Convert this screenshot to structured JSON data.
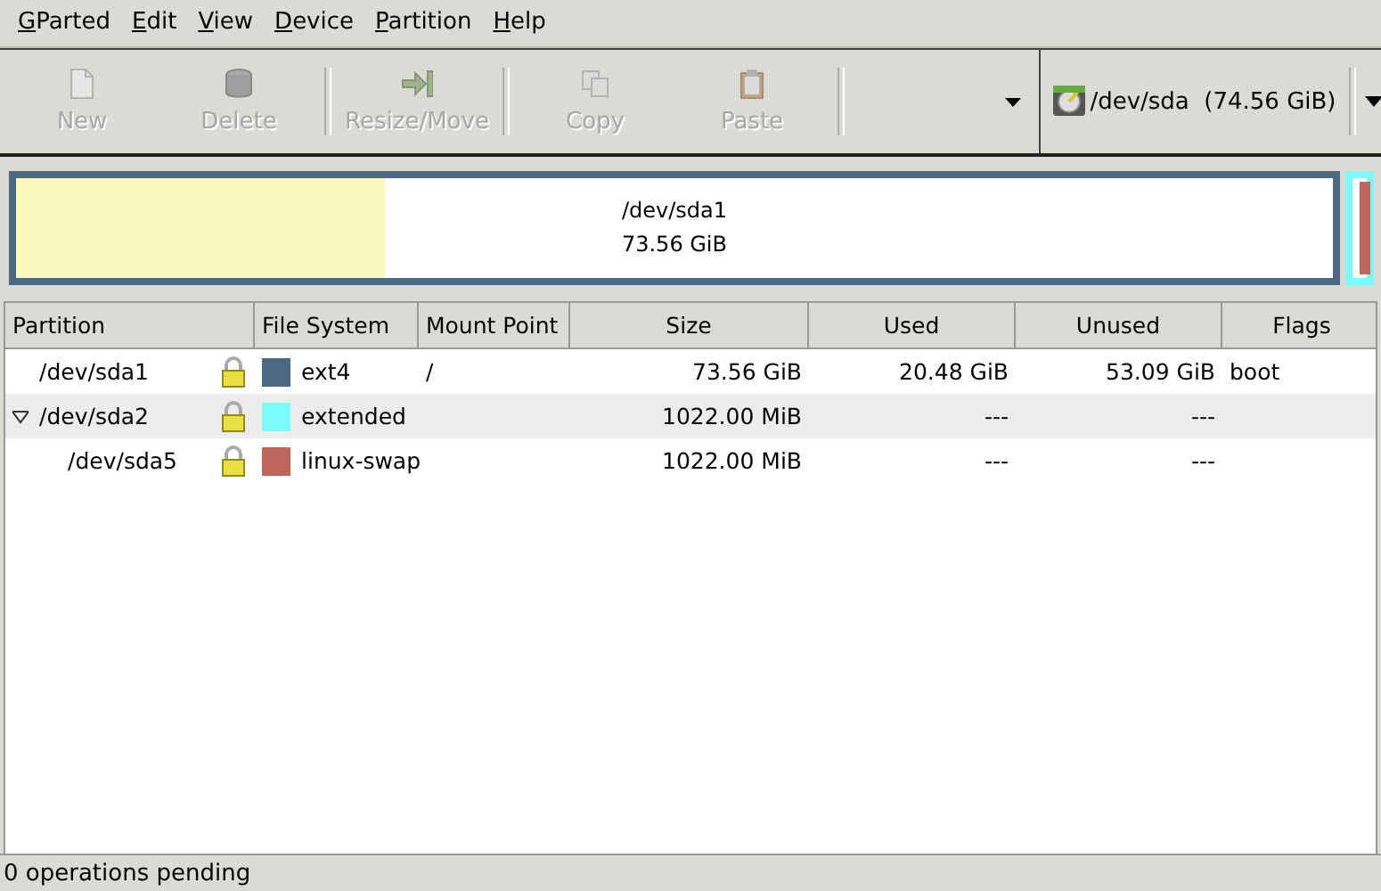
{
  "menu": [
    {
      "label": "GParted"
    },
    {
      "label": "Edit"
    },
    {
      "label": "View"
    },
    {
      "label": "Device"
    },
    {
      "label": "Partition"
    },
    {
      "label": "Help"
    }
  ],
  "toolbar": {
    "buttons": [
      {
        "kind": "new",
        "label": "New",
        "disabled": true,
        "separator_after": false
      },
      {
        "kind": "delete",
        "label": "Delete",
        "disabled": true,
        "separator_after": true
      },
      {
        "kind": "resize",
        "label": "Resize/Move",
        "disabled": true,
        "separator_after": true
      },
      {
        "kind": "copy",
        "label": "Copy",
        "disabled": true,
        "separator_after": false
      },
      {
        "kind": "paste",
        "label": "Paste",
        "disabled": true,
        "separator_after": true
      }
    ],
    "device": {
      "label": "/dev/sda  (74.56 GiB)"
    }
  },
  "disk_map": {
    "partitions": [
      {
        "kind": "primary",
        "name": "/dev/sda1",
        "size": "73.56 GiB",
        "color": "#4b6983",
        "level": 0.28
      },
      {
        "kind": "extended",
        "color": "#7bfbfb",
        "children": [
          {
            "color": "#c1665a"
          }
        ]
      }
    ]
  },
  "table": {
    "columns": [
      "Partition",
      "File System",
      "Mount Point",
      "Size",
      "Used",
      "Unused",
      "Flags"
    ],
    "rows": [
      {
        "partition": "/dev/sda1",
        "locked": true,
        "filesystem": "ext4",
        "color": "#4b6983",
        "mount": "/",
        "size": "73.56 GiB",
        "used": "20.48 GiB",
        "unused": "53.09 GiB",
        "flags": "boot"
      },
      {
        "partition": "/dev/sda2",
        "locked": true,
        "filesystem": "extended",
        "color": "#7bfbfb",
        "size": "1022.00 MiB",
        "used": "---",
        "unused": "---",
        "expanded": true,
        "children": [
          {
            "partition": "/dev/sda5",
            "locked": true,
            "filesystem": "linux-swap",
            "color": "#c1665a",
            "size": "1022.00 MiB",
            "used": "---",
            "unused": "---"
          }
        ]
      }
    ]
  },
  "status_bar": "0 operations pending"
}
